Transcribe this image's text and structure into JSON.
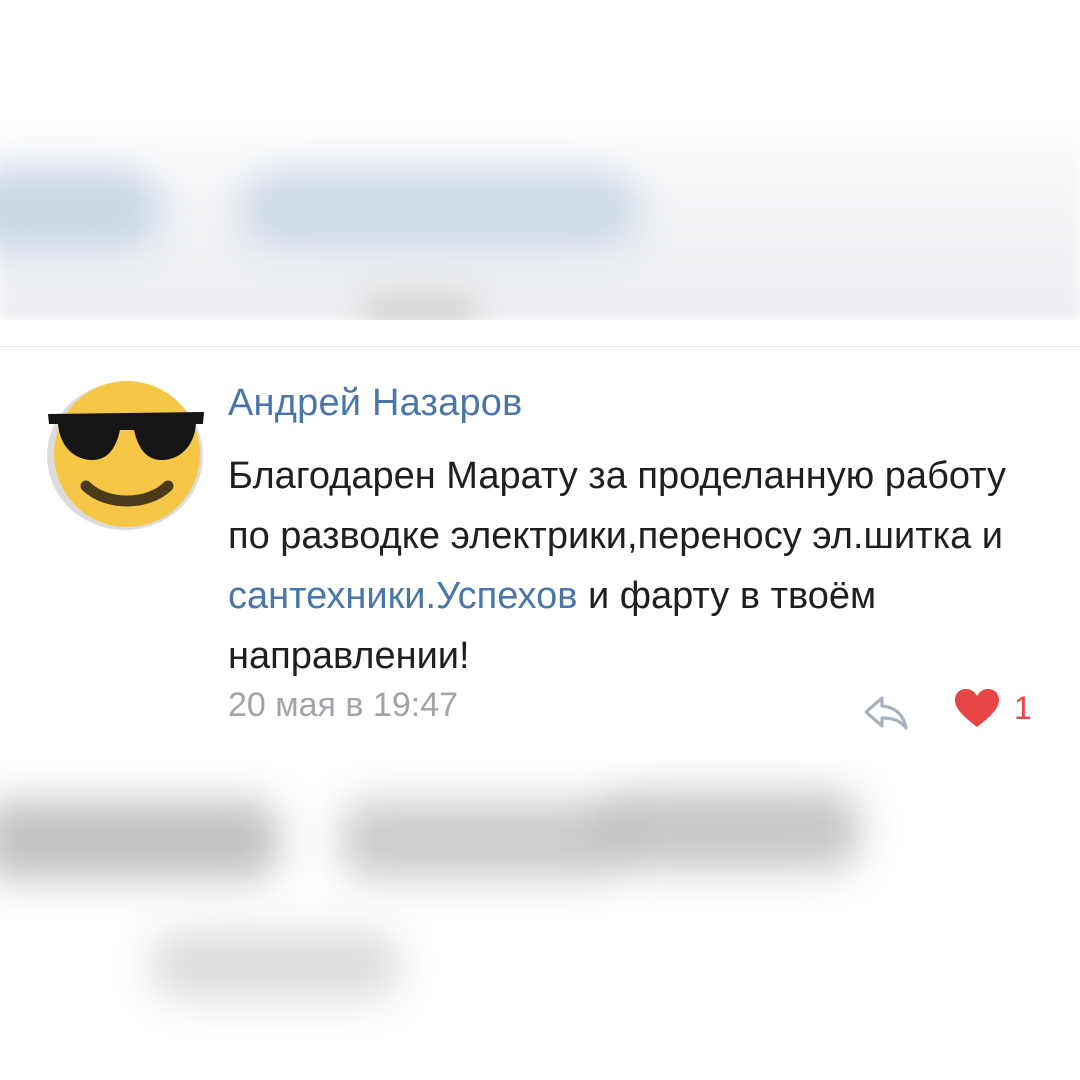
{
  "comment": {
    "author": "Андрей Назаров",
    "text_before_link": "Благодарен Марату за проделанную работу по разводке электрики,переносу эл.шитка и ",
    "link_text": "сантехники.Успехов",
    "text_after_link": " и фарту в твоём направлении!",
    "timestamp": "20 мая в 19:47",
    "like_count": "1",
    "avatar_icon": "sunglasses-emoji-icon",
    "reply_icon": "reply-icon",
    "like_icon": "heart-icon"
  },
  "colors": {
    "author": "#4a76a8",
    "link": "#4a76a8",
    "text": "#1f1f1f",
    "timestamp": "#a0a4a9",
    "heart": "#e64646"
  }
}
